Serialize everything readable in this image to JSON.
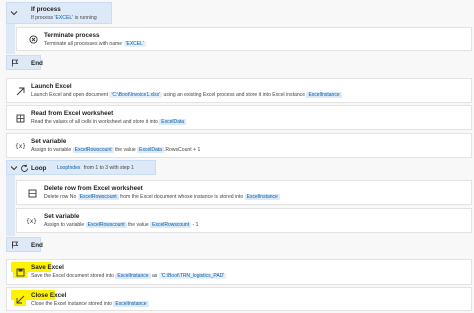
{
  "colors": {
    "accent": "#0f5aa6",
    "chip_bg": "#dcebf9",
    "container_bg": "#dde9f7",
    "highlight": "#fff200"
  },
  "steps": {
    "if_process": {
      "title": "If process",
      "desc_prefix": "If process ",
      "desc_value": "'EXCEL'",
      "desc_suffix": " is running",
      "icon": "collapse-chevron-icon"
    },
    "terminate": {
      "title": "Terminate process",
      "desc_prefix": "Terminate all processes with name ",
      "desc_value": "'EXCEL'",
      "icon": "terminate-icon"
    },
    "end1": {
      "title": "End",
      "icon": "flag-icon"
    },
    "launch_excel": {
      "title": "Launch Excel",
      "desc_prefix": "Launch Excel and open document ",
      "desc_value": "'C:\\Boot\\Invoice1.xlsx'",
      "desc_mid": " using an existing Excel process and store it into Excel instance ",
      "desc_var": "ExcelInstance",
      "icon": "launch-arrow-icon"
    },
    "read_ws": {
      "title": "Read from Excel worksheet",
      "desc_prefix": "Read the values of all cells in worksheet and store it into ",
      "desc_var": "ExcelData",
      "icon": "read-icon"
    },
    "set_variable1": {
      "title": "Set variable",
      "desc_prefix": "Assign to variable ",
      "var1": "ExcelRowscount",
      "desc_mid": " the value ",
      "var2": "ExcelData",
      "desc_suffix": ".RowsCount + 1",
      "icon": "variable-icon"
    },
    "loop": {
      "title": "Loop",
      "var": "LoopIndex",
      "desc": " from 1 to 3 with step 1",
      "icon": "loop-icon"
    },
    "delete_row": {
      "title": "Delete row from Excel worksheet",
      "desc_prefix": "Delete row No ",
      "var1": "ExcelRowscount",
      "desc_mid": " from the Excel document whose instance is stored into ",
      "var2": "ExcelInstance",
      "icon": "delete-row-icon"
    },
    "set_variable2": {
      "title": "Set variable",
      "desc_prefix": "Assign to variable ",
      "var1": "ExcelRowscount",
      "desc_mid": " the value ",
      "var2": "ExcelRowscount",
      "desc_suffix": " - 1",
      "icon": "variable-icon"
    },
    "end2": {
      "title": "End",
      "icon": "flag-icon"
    },
    "save_excel": {
      "title": "Save Excel",
      "desc_prefix": "Save the Excel document stored into ",
      "var1": "ExcelInstance",
      "desc_mid": " as ",
      "desc_value": "'C:\\Boot\\TRN_logistics_PAD'",
      "icon": "save-excel-icon"
    },
    "close_excel": {
      "title": "Close Excel",
      "desc_prefix": "Close the Excel instance stored into ",
      "var1": "ExcelInstance",
      "icon": "close-excel-icon"
    }
  }
}
